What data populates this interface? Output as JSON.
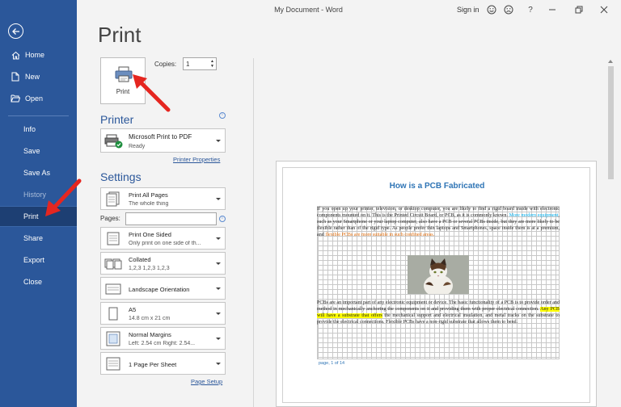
{
  "window": {
    "title": "My Document  -  Word",
    "signin": "Sign in",
    "icons": [
      "smile-icon",
      "frown-icon",
      "help-icon",
      "restore-icon",
      "close-icon"
    ]
  },
  "sidebar": {
    "items": [
      {
        "label": "Home",
        "icon": "home-icon"
      },
      {
        "label": "New",
        "icon": "new-doc-icon"
      },
      {
        "label": "Open",
        "icon": "folder-open-icon"
      },
      {
        "label": "Info"
      },
      {
        "label": "Save"
      },
      {
        "label": "Save As"
      },
      {
        "label": "History"
      },
      {
        "label": "Print"
      },
      {
        "label": "Share"
      },
      {
        "label": "Export"
      },
      {
        "label": "Close"
      }
    ],
    "selected": "Print",
    "color": "#2b579a"
  },
  "print": {
    "title": "Print",
    "button_label": "Print",
    "copies_label": "Copies:",
    "copies_value": "1"
  },
  "printer": {
    "heading": "Printer",
    "name": "Microsoft Print to PDF",
    "status": "Ready",
    "properties_link": "Printer Properties"
  },
  "settings": {
    "heading": "Settings",
    "print_range": {
      "line1": "Print All Pages",
      "line2": "The whole thing"
    },
    "pages_label": "Pages:",
    "pages_value": "",
    "sides": {
      "line1": "Print One Sided",
      "line2": "Only print on one side of th..."
    },
    "collation": {
      "line1": "Collated",
      "line2": "1,2,3    1,2,3    1,2,3"
    },
    "orientation": {
      "line1": "Landscape Orientation"
    },
    "paper": {
      "line1": "A5",
      "line2": "14.8 cm x 21 cm"
    },
    "margins": {
      "line1": "Normal Margins",
      "line2": "Left:  2.54 cm    Right:  2.54..."
    },
    "per_sheet": {
      "line1": "1 Page Per Sheet"
    },
    "page_setup_link": "Page Setup"
  },
  "preview": {
    "heading": "How is a PCB Fabricated",
    "para1_a": "If you open up your printer, television, or desktop computer, you are likely to find a rigid board inside with electronic components mounted on it. This is the Printed Circuit Board, or PCB, as it is commonly known. ",
    "para1_blue": "More modern equipment",
    "para1_b": ", such as your Smartphone or your laptop computer, also have a PCB or several PCBs inside, but they are more likely to be flexible rather than of the rigid type. As people prefer thin laptops and Smartphones, space inside them is at a premium, and ",
    "para1_orange": "flexible PCBs are more suitable in such confined areas.",
    "para2_a": "PCBs are an important part of any electronic equipment or device. The basic functionality of a PCB is to provide order and method in mechanically anchoring the components on it and providing them with proper electrical connection. ",
    "para2_yellow": "Any PCB will have a substrate that offers",
    "para2_b": " the mechanical support and electrical insulation, and metal tracks on the substrate to provide the electrical connections. Flexible PCBs have a non-rigid substrate that allows them to bend.",
    "page_indicator": "page, 1 of 14"
  }
}
